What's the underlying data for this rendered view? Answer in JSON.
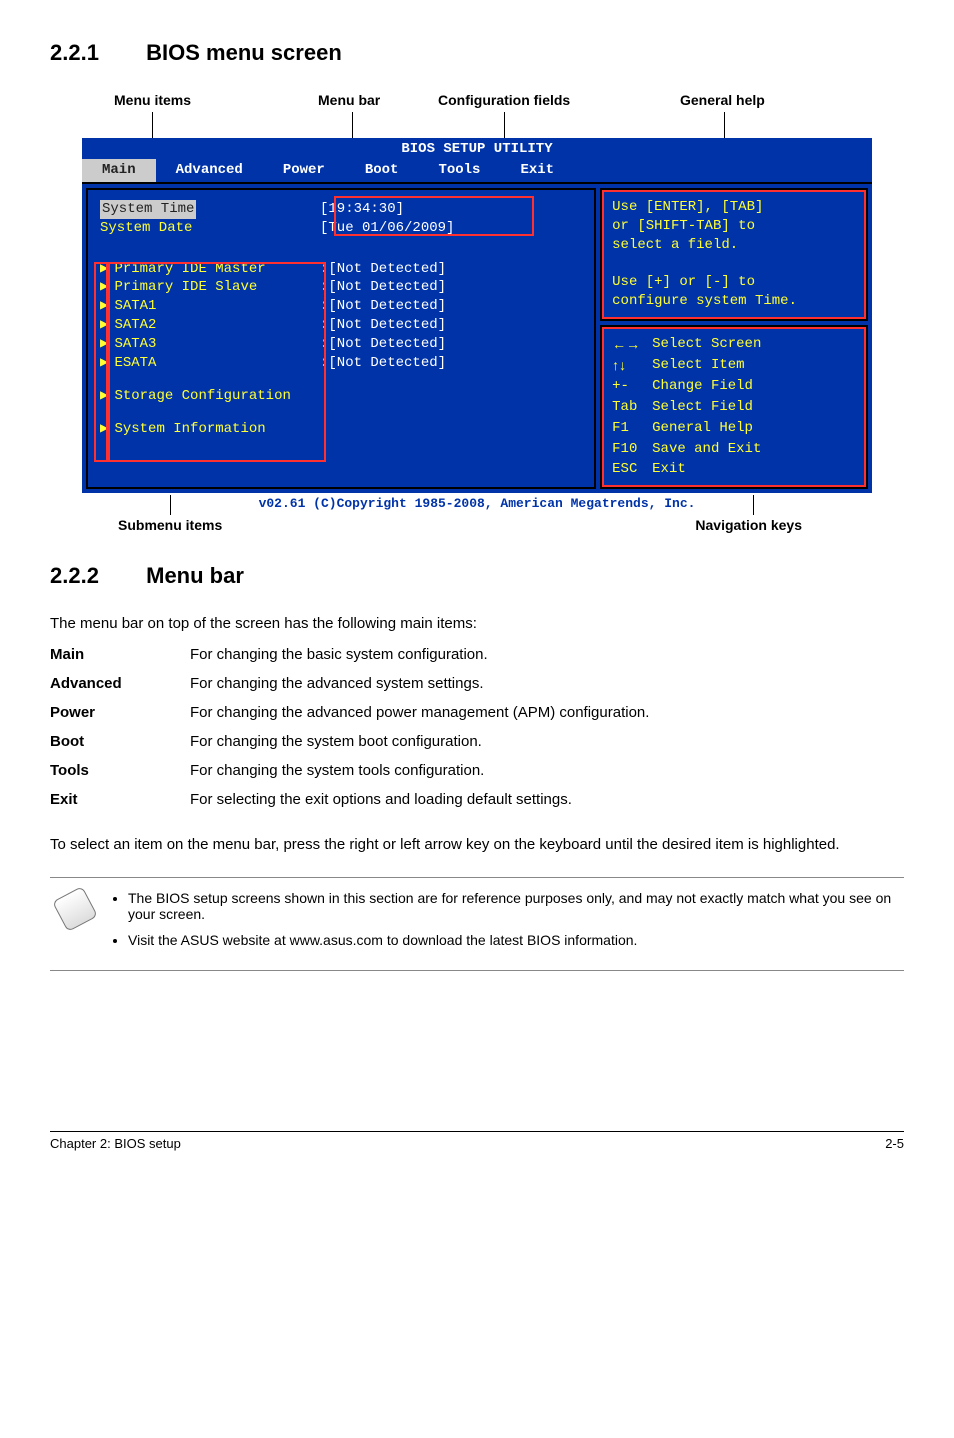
{
  "section1": {
    "num": "2.2.1",
    "title": "BIOS menu screen"
  },
  "annot": {
    "menu_items": "Menu items",
    "menu_bar": "Menu bar",
    "config_fields": "Configuration fields",
    "general_help": "General help",
    "submenu_items": "Submenu items",
    "nav_keys": "Navigation keys"
  },
  "bios": {
    "title": "BIOS SETUP UTILITY",
    "tabs": [
      "Main",
      "Advanced",
      "Power",
      "Boot",
      "Tools",
      "Exit"
    ],
    "system_time_label": "System Time",
    "system_date_label": "System Date",
    "system_time": "[19:34:30]",
    "system_date": "[Tue 01/06/2009]",
    "rows": [
      {
        "label": "Primary IDE Master",
        "value": ":[Not Detected]"
      },
      {
        "label": "Primary IDE Slave",
        "value": ":[Not Detected]"
      },
      {
        "label": "SATA1",
        "value": ":[Not Detected]"
      },
      {
        "label": "SATA2",
        "value": ":[Not Detected]"
      },
      {
        "label": "SATA3",
        "value": ":[Not Detected]"
      },
      {
        "label": "ESATA",
        "value": ":[Not Detected]"
      }
    ],
    "extra": [
      "Storage Configuration",
      "System Information"
    ],
    "help_top": [
      "Use [ENTER], [TAB]",
      "or [SHIFT-TAB] to",
      "select a field.",
      "",
      "Use [+] or [-] to",
      "configure system Time."
    ],
    "help_keys": [
      {
        "k": "←→",
        "d": "Select Screen"
      },
      {
        "k": "↑↓",
        "d": "Select Item"
      },
      {
        "k": "+-",
        "d": "Change Field"
      },
      {
        "k": "Tab",
        "d": "Select Field"
      },
      {
        "k": "F1",
        "d": "General Help"
      },
      {
        "k": "F10",
        "d": "Save and Exit"
      },
      {
        "k": "ESC",
        "d": "Exit"
      }
    ],
    "footer": "v02.61 (C)Copyright 1985-2008, American Megatrends, Inc."
  },
  "section2": {
    "num": "2.2.2",
    "title": "Menu bar"
  },
  "menubar_lead": "The menu bar on top of the screen has the following main items:",
  "opts": [
    {
      "k": "Main",
      "d": "For changing the basic system configuration."
    },
    {
      "k": "Advanced",
      "d": "For changing the advanced system settings."
    },
    {
      "k": "Power",
      "d": "For changing the advanced power management (APM) configuration."
    },
    {
      "k": "Boot",
      "d": "For changing the system boot configuration."
    },
    {
      "k": "Tools",
      "d": "For changing the system tools configuration."
    },
    {
      "k": "Exit",
      "d": "For selecting the exit options and loading default settings."
    }
  ],
  "para_after": "To select an item on the menu bar, press the right or left arrow key on the keyboard until the desired item is highlighted.",
  "notes": [
    "The BIOS setup screens shown in this section are for reference purposes only, and may not exactly match what you see on your screen.",
    "Visit the ASUS website at www.asus.com to download the latest BIOS information."
  ],
  "foot": {
    "left": "Chapter 2: BIOS setup",
    "right": "2-5"
  }
}
